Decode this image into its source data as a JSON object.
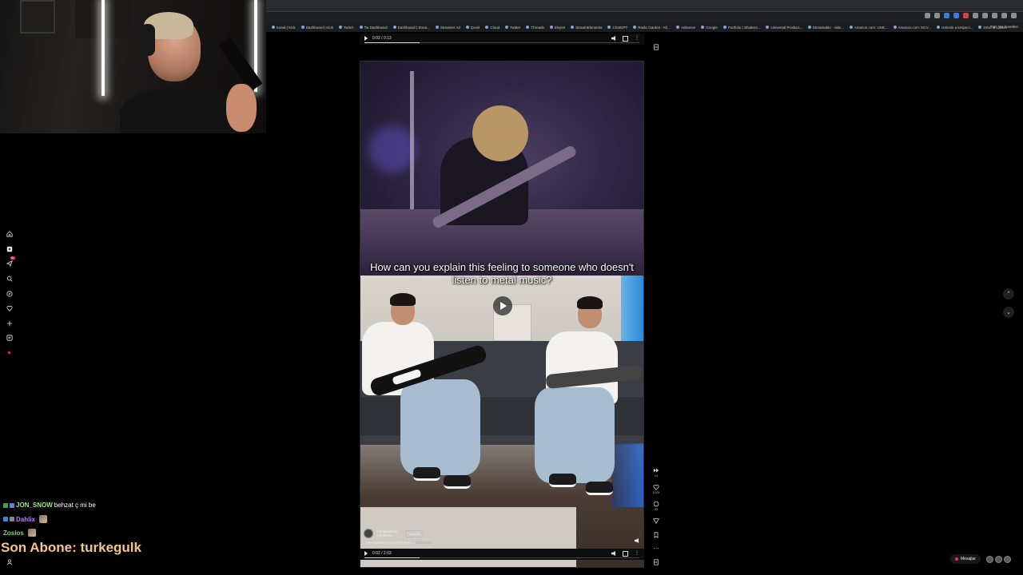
{
  "browser": {
    "bookmarks": [
      "Kanal | Kick",
      "Dashboard | Kick",
      "Twitch",
      "Tw Dashboard",
      "Dashboard | Strea...",
      "Streamer Ad",
      "Çeviri",
      "Cloud",
      "Twitter",
      "Threads",
      "Ekşisö",
      "StreamElements",
      "ChatGPT",
      "Radio Garden - Kli...",
      "AdSense",
      "Google",
      "Portfolio | Shutters...",
      "Universal Product...",
      "Streamable - vide...",
      "Amazon.com: USB...",
      "Amazon.com: NCV...",
      "Gelenik a kespeci...",
      "Drive & Listen"
    ],
    "bookmarks_right": "Tüm Yer İşaretleri"
  },
  "top_player": {
    "time": "0:02 / 0:13",
    "progress": 0.2
  },
  "video": {
    "caption": "How can you explain this feeling to someone who doesn't listen to metal music?",
    "author": "meritbaserari",
    "author_sub": "meritbase",
    "follow_label": "Takip Et",
    "description": "The saddest song of all time...",
    "more_label": "daha fazla",
    "time": "0:02 / 2:03",
    "progress": 0.2
  },
  "side_actions": {
    "views": "14",
    "likes": "5.525",
    "comments": "38"
  },
  "leftnav": {
    "notif_badge": "9+"
  },
  "chat": {
    "lines": [
      {
        "user": "JON_SNOW",
        "msg": "behzat ç mi be",
        "color": "#9bf06a"
      },
      {
        "user": "Dahlix",
        "msg": "",
        "color": "#c77bff"
      },
      {
        "user": "Zosios",
        "msg": "",
        "color": "#7ad96a"
      }
    ],
    "sub_text": "Son Abone: turkegulk"
  },
  "messages": {
    "label": "Mesajlar"
  },
  "colors": {
    "accent": "#ff2b4f",
    "sub_text": "#f5c68a"
  }
}
